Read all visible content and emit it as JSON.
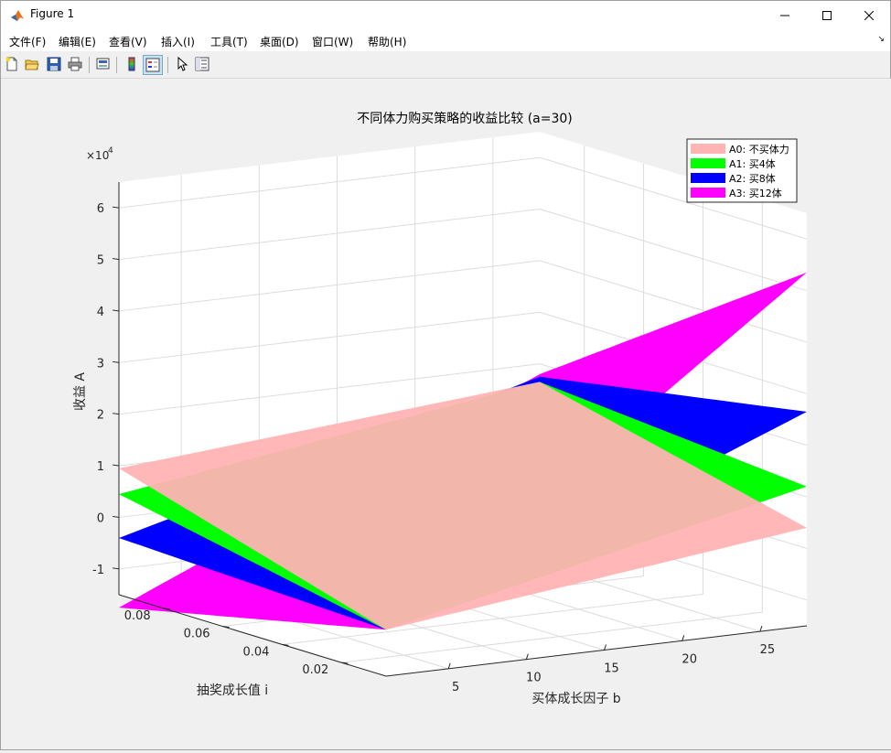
{
  "window": {
    "title": "Figure 1"
  },
  "menu": [
    {
      "label": "文件(F)"
    },
    {
      "label": "编辑(E)"
    },
    {
      "label": "查看(V)"
    },
    {
      "label": "插入(I)"
    },
    {
      "label": "工具(T)"
    },
    {
      "label": "桌面(D)"
    },
    {
      "label": "窗口(W)"
    },
    {
      "label": "帮助(H)"
    }
  ],
  "toolbar": [
    "new-figure-icon",
    "open-file-icon",
    "save-icon",
    "print-icon",
    "link-plot-icon",
    "colorbar-icon",
    "legend-icon",
    "pointer-icon",
    "property-inspector-icon"
  ],
  "chart_data": {
    "type": "surface3d",
    "title": "不同体力购买策略的收益比较 (a=30)",
    "xlabel": "买体成长因子 b",
    "ylabel": "抽奖成长值 i",
    "zlabel": "收益 A",
    "z_multiplier": "×10^4",
    "z_multiplier_base": "×10",
    "z_multiplier_exp": "4",
    "xticks": [
      5,
      10,
      15,
      20,
      25
    ],
    "yticks": [
      0.02,
      0.04,
      0.06,
      0.08
    ],
    "zticks": [
      -1,
      0,
      1,
      2,
      3,
      4,
      5,
      6
    ],
    "xticks_text": [
      "5",
      "10",
      "15",
      "20",
      "25"
    ],
    "yticks_text": [
      "0.02",
      "0.04",
      "0.06",
      "0.08"
    ],
    "zticks_text": [
      "-1",
      "0",
      "1",
      "2",
      "3",
      "4",
      "5",
      "6"
    ],
    "xlim": [
      1,
      28
    ],
    "ylim": [
      0.005,
      0.095
    ],
    "zlim": [
      -1.5,
      6.5
    ],
    "grid": true,
    "legend_position": "top-right",
    "series": [
      {
        "name": "A0: 不买体力",
        "color": "#ffb3b3",
        "corners_z_1e4": {
          "b_min_i_min": -0.6,
          "b_min_i_max": 0.95,
          "b_max_i_min": 0.4,
          "b_max_i_max": 1.65
        }
      },
      {
        "name": "A1: 买4体",
        "color": "#00ff00",
        "corners_z_1e4": {
          "b_min_i_min": -0.6,
          "b_min_i_max": 0.45,
          "b_max_i_min": 1.2,
          "b_max_i_max": 1.65
        }
      },
      {
        "name": "A2: 买8体",
        "color": "#0000ff",
        "corners_z_1e4": {
          "b_min_i_min": -0.6,
          "b_min_i_max": -0.4,
          "b_max_i_min": 2.65,
          "b_max_i_max": 1.75
        }
      },
      {
        "name": "A3: 买12体",
        "color": "#ff00ff",
        "corners_z_1e4": {
          "b_min_i_min": -0.6,
          "b_min_i_max": -1.75,
          "b_max_i_min": 5.35,
          "b_max_i_max": 1.8
        }
      }
    ]
  }
}
